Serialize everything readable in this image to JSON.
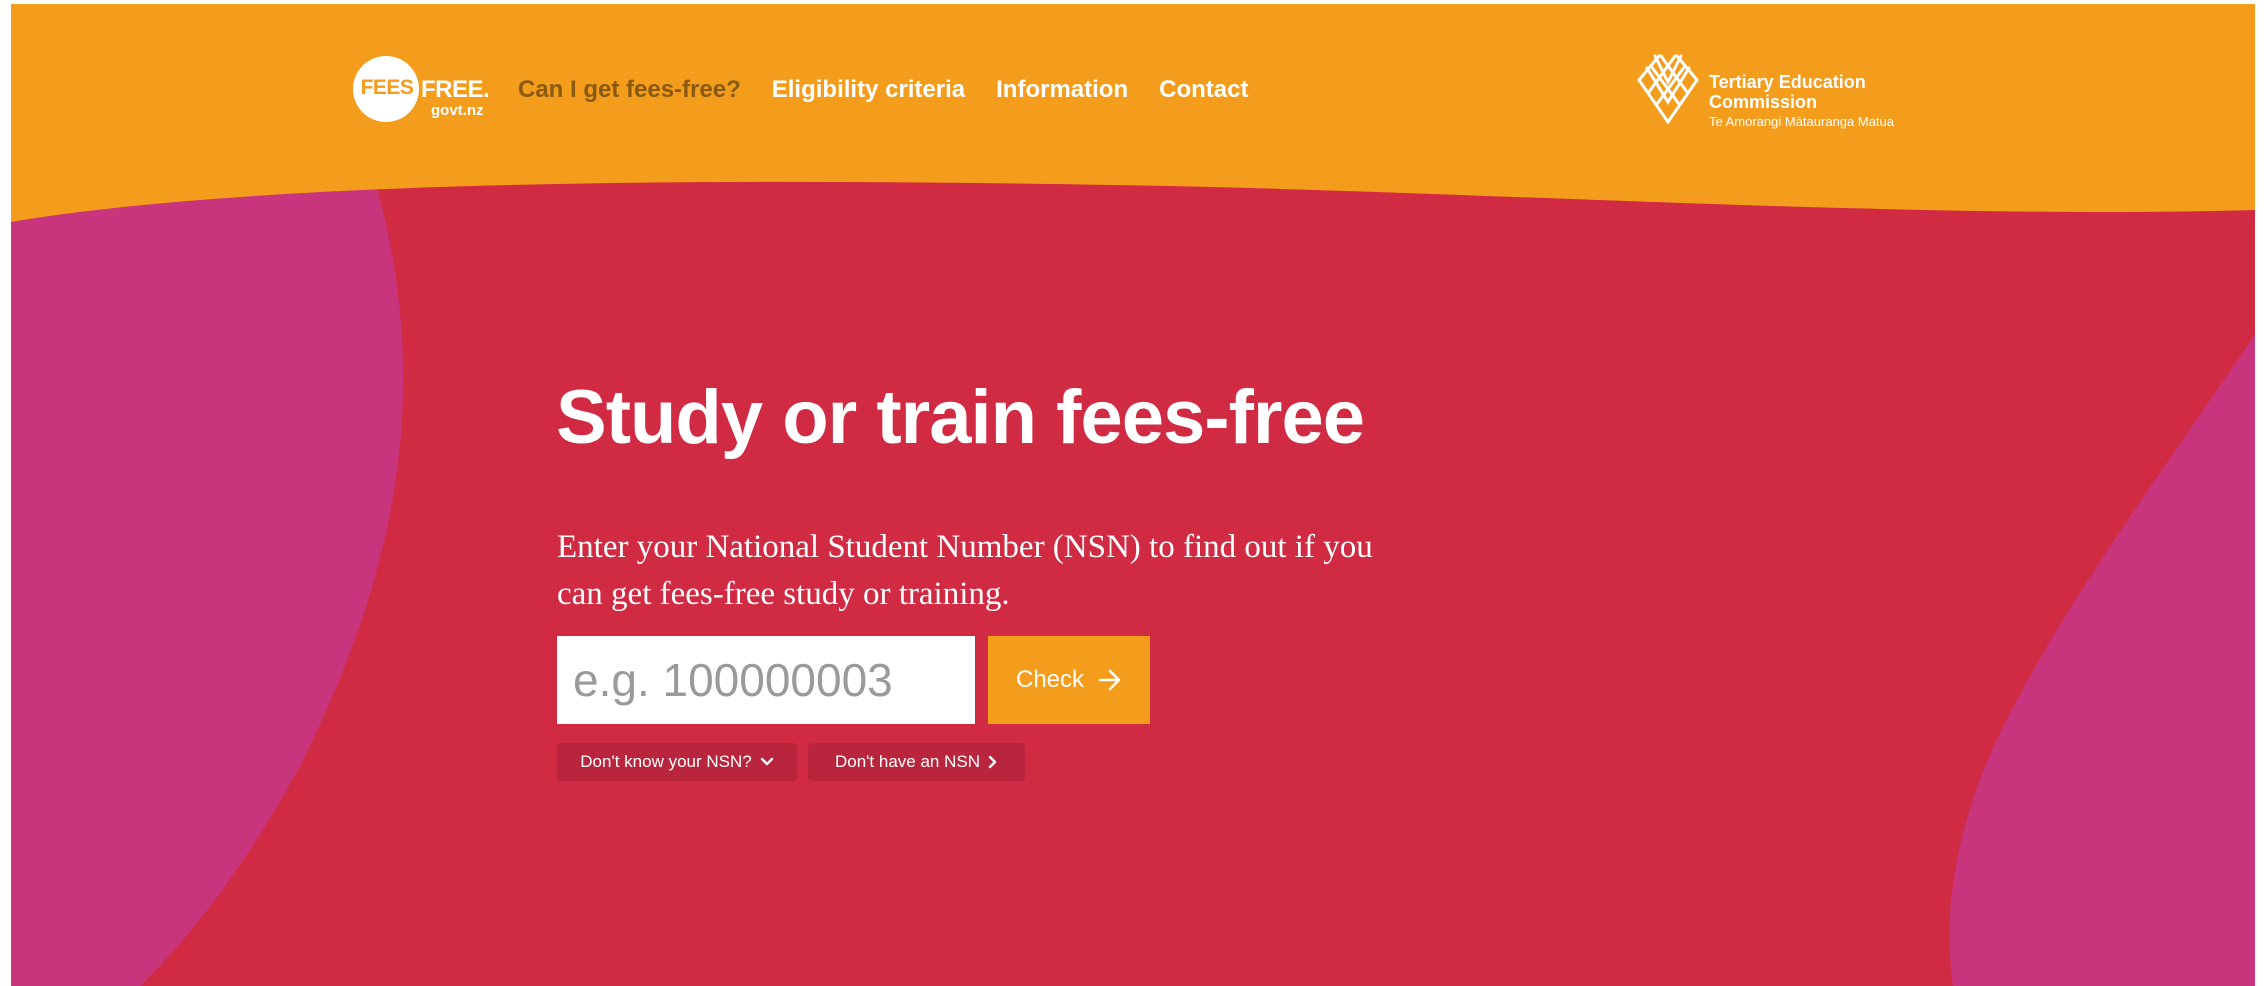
{
  "colors": {
    "header_orange": "#f49c1b",
    "hero_red": "#d12a43",
    "accent_pink": "#c8357d",
    "nav_active": "#8a5a10",
    "pill_dark_red": "#b8253c"
  },
  "logo": {
    "fees": "FEES",
    "free": "FREE.",
    "govt": "govt.nz"
  },
  "nav": {
    "items": [
      {
        "label": "Can I get fees-free?",
        "active": true
      },
      {
        "label": "Eligibility criteria",
        "active": false
      },
      {
        "label": "Information",
        "active": false
      },
      {
        "label": "Contact",
        "active": false
      }
    ]
  },
  "tec": {
    "line1": "Tertiary Education",
    "line2": "Commission",
    "line3": "Te Amorangi Mātauranga Matua",
    "icon": "tec-lattice-logo-icon"
  },
  "hero": {
    "title": "Study or train fees-free",
    "text": "Enter your National Student Number (NSN) to find out if you can get fees-free study or training.",
    "input_placeholder": "e.g. 100000003",
    "check_label": "Check",
    "check_icon": "arrow-right-icon",
    "dont_know_label": "Don't know your NSN?",
    "dont_know_icon": "chevron-down-icon",
    "dont_have_label": "Don't have an NSN",
    "dont_have_icon": "chevron-right-icon"
  }
}
